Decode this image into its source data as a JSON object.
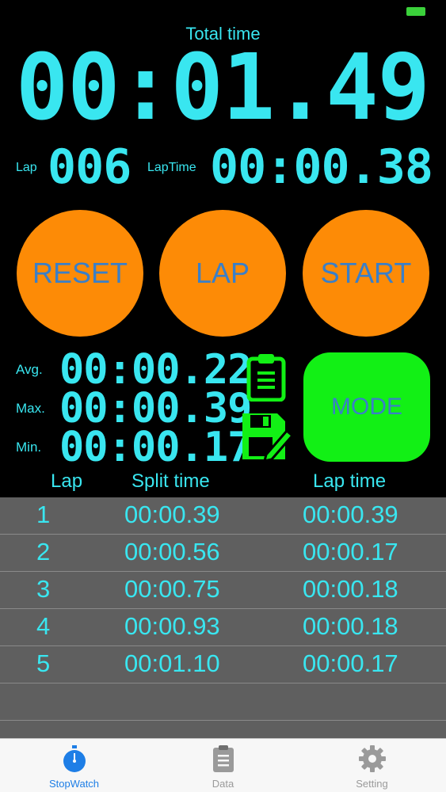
{
  "header": {
    "total_label": "Total time",
    "total_time": "00:01.49",
    "lap_label": "Lap",
    "lap_number": "006",
    "laptime_label": "LapTime",
    "laptime_value": "00:00.38"
  },
  "buttons": {
    "reset": "RESET",
    "lap": "LAP",
    "start": "START",
    "mode": "MODE"
  },
  "stats": {
    "avg_label": "Avg.",
    "avg_value": "00:00.22",
    "max_label": "Max.",
    "max_value": "00:00.39",
    "min_label": "Min.",
    "min_value": "00:00.17"
  },
  "table": {
    "headers": [
      "Lap",
      "Split time",
      "Lap time"
    ],
    "rows": [
      {
        "lap": "1",
        "split": "00:00.39",
        "laptime": "00:00.39"
      },
      {
        "lap": "2",
        "split": "00:00.56",
        "laptime": "00:00.17"
      },
      {
        "lap": "3",
        "split": "00:00.75",
        "laptime": "00:00.18"
      },
      {
        "lap": "4",
        "split": "00:00.93",
        "laptime": "00:00.18"
      },
      {
        "lap": "5",
        "split": "00:01.10",
        "laptime": "00:00.17"
      }
    ]
  },
  "tabs": [
    {
      "label": "StopWatch",
      "icon": "stopwatch-icon",
      "active": true
    },
    {
      "label": "Data",
      "icon": "clipboard-icon",
      "active": false
    },
    {
      "label": "Setting",
      "icon": "gear-icon",
      "active": false
    }
  ],
  "colors": {
    "accent": "#39e6f0",
    "button_orange": "#fd8b06",
    "mode_green": "#12f015",
    "tab_active": "#1e7ee6"
  }
}
